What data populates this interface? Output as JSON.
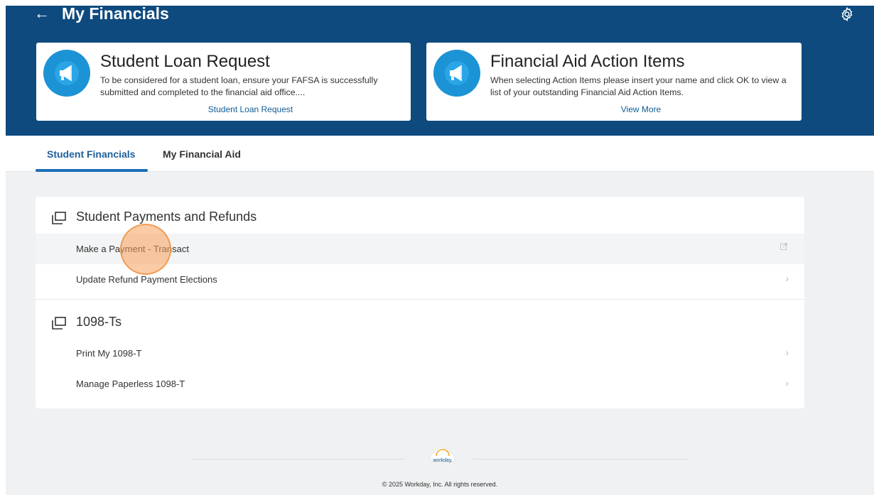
{
  "header": {
    "back_label": "←",
    "title": "My Financials",
    "settings_icon": "gear-icon",
    "bg_color": "#0e4a7e"
  },
  "cards": [
    {
      "title": "Student Loan Request",
      "description": "To be considered for a student loan, ensure your FAFSA is successfully submitted and completed to the financial aid office....",
      "link": "Student Loan Request",
      "icon": "megaphone-icon"
    },
    {
      "title": "Financial Aid Action Items",
      "description": "When selecting Action Items please insert your name and click OK to view a list of your outstanding Financial Aid Action Items.",
      "link": "View More",
      "icon": "megaphone-icon"
    }
  ],
  "tabs": [
    {
      "label": "Student Financials",
      "active": true
    },
    {
      "label": "My Financial Aid",
      "active": false
    }
  ],
  "sections": [
    {
      "title": "Student Payments and Refunds",
      "icon": "window-stack-icon",
      "items": [
        {
          "label": "Make a Payment - Transact",
          "icon": "external-link-icon"
        },
        {
          "label": "Update Refund Payment Elections",
          "icon": "chevron-right-icon"
        }
      ]
    },
    {
      "title": "1098-Ts",
      "icon": "window-stack-icon",
      "items": [
        {
          "label": "Print My 1098-T",
          "icon": "chevron-right-icon"
        },
        {
          "label": "Manage Paperless 1098-T",
          "icon": "chevron-right-icon"
        }
      ]
    }
  ],
  "footer": {
    "logo_text": "workday.",
    "copyright": "© 2025 Workday, Inc. All rights reserved."
  },
  "colors": {
    "accent": "#1c6fb8",
    "icon_blue": "#1c93d5",
    "cursor": "#f5a05a"
  }
}
